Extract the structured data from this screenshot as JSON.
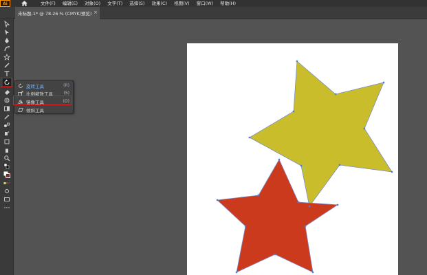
{
  "app": {
    "logo": "Ai"
  },
  "menu": [
    "文件(F)",
    "编辑(E)",
    "对象(O)",
    "文字(T)",
    "选择(S)",
    "效果(C)",
    "视图(V)",
    "窗口(W)",
    "帮助(H)"
  ],
  "document_tab": {
    "title": "未标题-1* @ 78.26 % (CMYK/预览)",
    "close": "×"
  },
  "flyout": {
    "items": [
      {
        "label": "旋转工具",
        "shortcut": "(R)"
      },
      {
        "label": "比例缩放工具",
        "shortcut": "(S)"
      },
      {
        "label": "镜像工具",
        "shortcut": "(O)"
      },
      {
        "label": "倾斜工具",
        "shortcut": ""
      }
    ]
  },
  "canvas": {
    "yellow_star_color": "#c9bd2b",
    "red_star_color": "#cc3a1e",
    "anchor_color": "#4a7fd6"
  }
}
